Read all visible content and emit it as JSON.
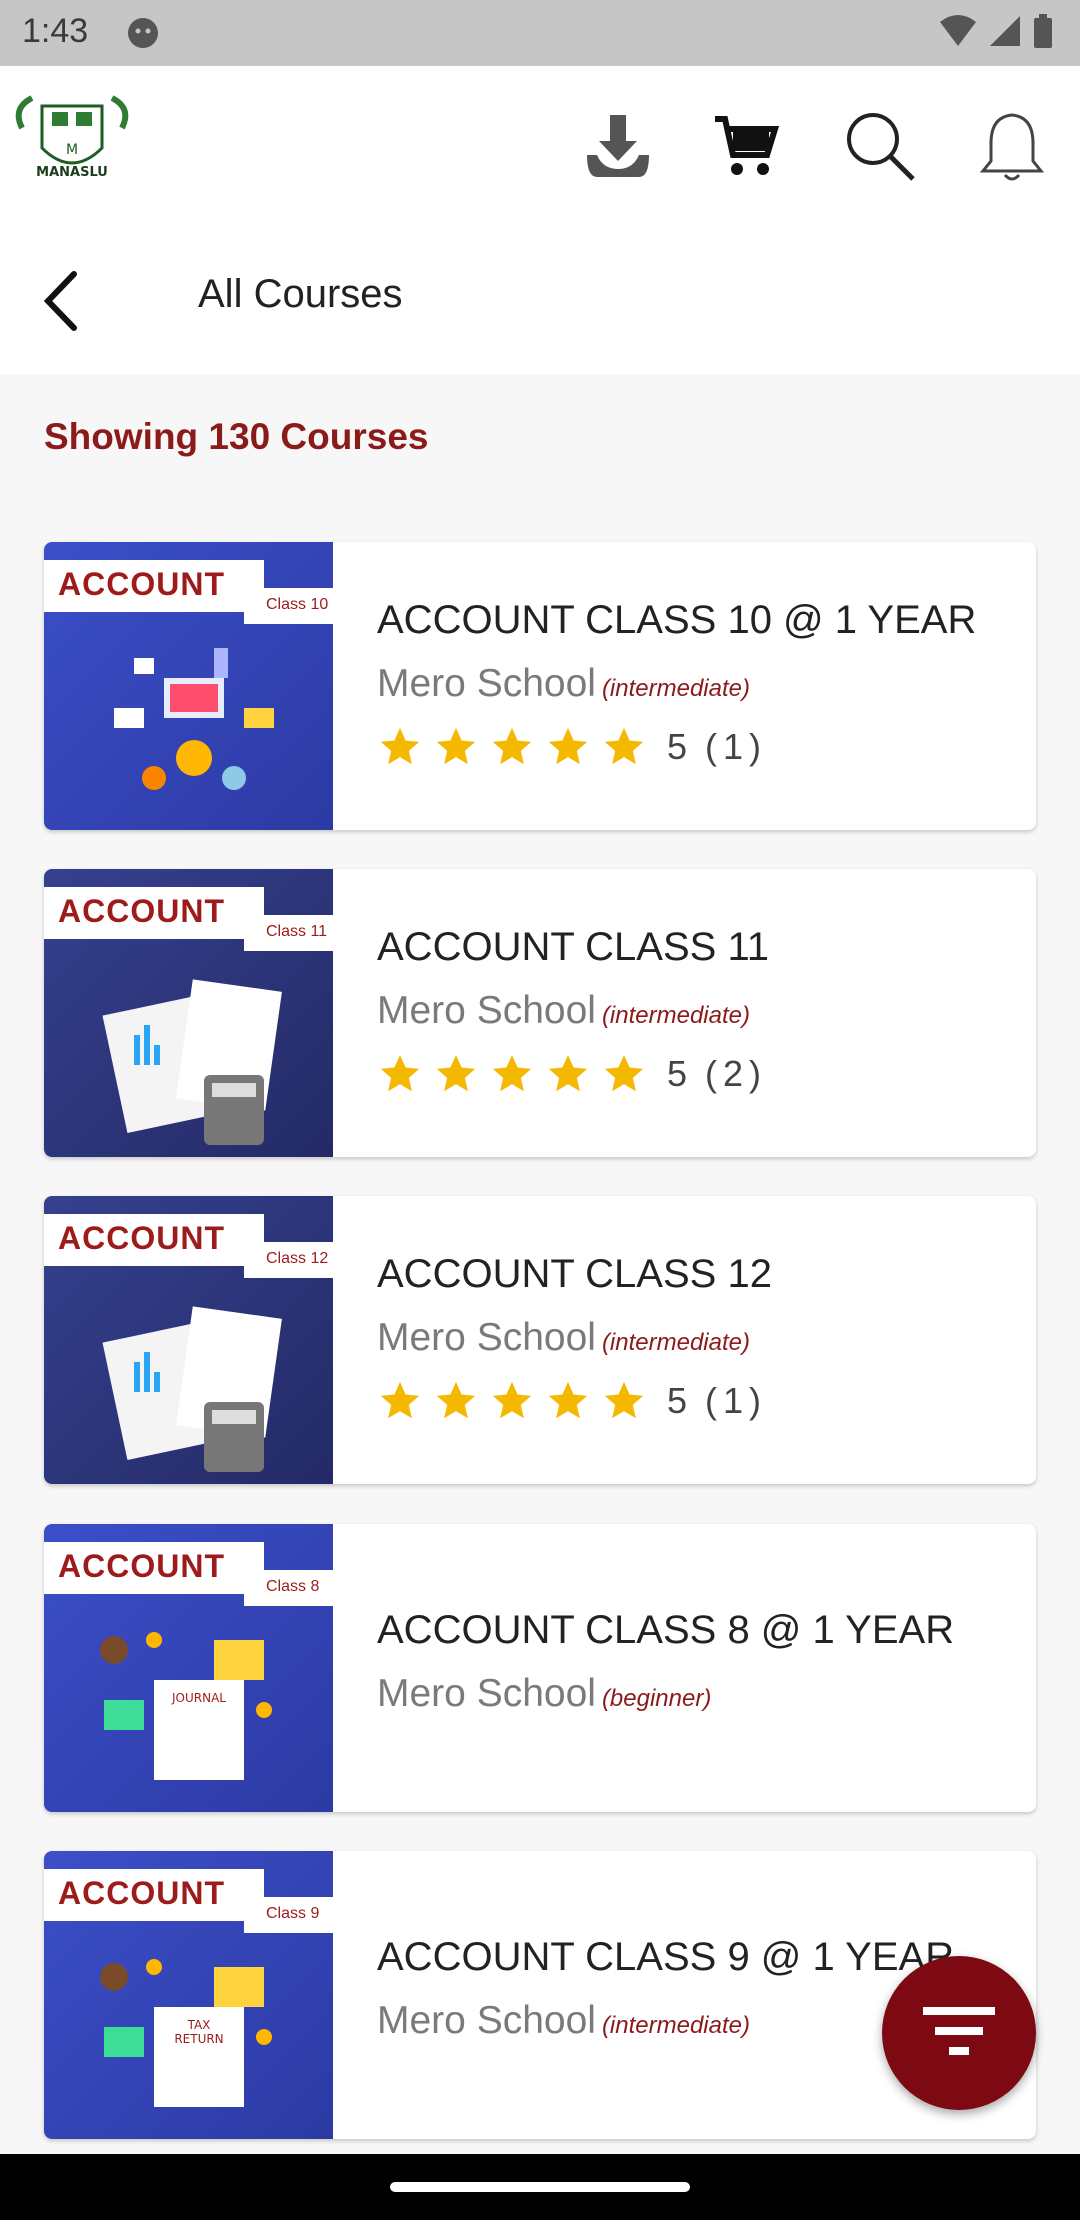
{
  "status_bar": {
    "time": "1:43"
  },
  "header": {
    "logo_text": "MANASLU",
    "icons": [
      "download-icon",
      "cart-icon",
      "search-icon",
      "notification-bell-icon"
    ]
  },
  "titlebar": {
    "title": "All Courses"
  },
  "main": {
    "showing_text": "Showing 130 Courses",
    "courses": [
      {
        "tag": "ACCOUNT",
        "class_tag": "Class 10",
        "title": "ACCOUNT CLASS 10 @ 1 YEAR",
        "school": "Mero School",
        "level": "(intermediate)",
        "rating": "5",
        "count": "(1)",
        "stars": 5
      },
      {
        "tag": "ACCOUNT",
        "class_tag": "Class 11",
        "title": "ACCOUNT CLASS 11",
        "school": "Mero School",
        "level": "(intermediate)",
        "rating": "5",
        "count": "(2)",
        "stars": 5
      },
      {
        "tag": "ACCOUNT",
        "class_tag": "Class 12",
        "title": "ACCOUNT CLASS 12",
        "school": "Mero School",
        "level": "(intermediate)",
        "rating": "5",
        "count": "(1)",
        "stars": 5
      },
      {
        "tag": "ACCOUNT",
        "class_tag": "Class 8",
        "title": "ACCOUNT CLASS 8 @ 1 YEAR",
        "school": "Mero School",
        "level": "(beginner)"
      },
      {
        "tag": "ACCOUNT",
        "class_tag": "Class 9",
        "title": "ACCOUNT CLASS 9 @ 1 YEAR",
        "school": "Mero School",
        "level": "(intermediate)"
      }
    ]
  },
  "colors": {
    "accent": "#8b1a1a",
    "fab": "#7d0a12",
    "star": "#f5b800"
  }
}
